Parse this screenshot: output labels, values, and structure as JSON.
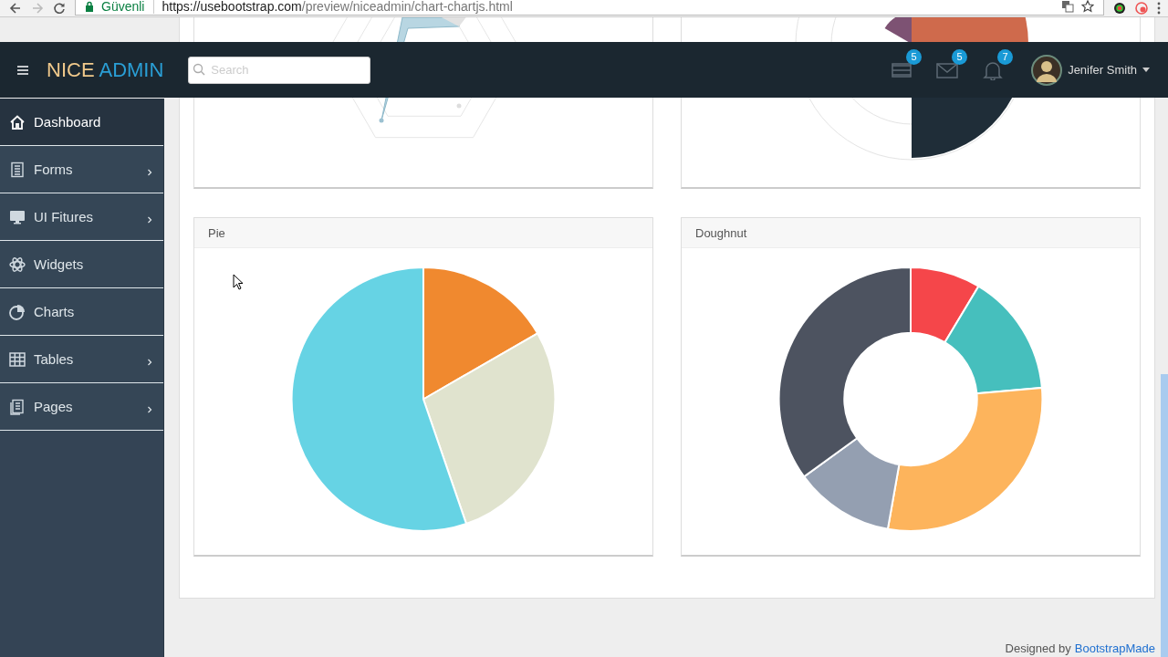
{
  "browser": {
    "security_label": "Güvenli",
    "url_domain": "https://usebootstrap.com",
    "url_path": "/preview/niceadmin/chart-chartjs.html"
  },
  "header": {
    "logo_first": "NICE",
    "logo_second": "ADMIN",
    "search": {
      "placeholder": "Search"
    },
    "notifications": [
      {
        "kind": "tasks",
        "count": "5"
      },
      {
        "kind": "messages",
        "count": "5"
      },
      {
        "kind": "alerts",
        "count": "7"
      }
    ],
    "user": {
      "name": "Jenifer Smith"
    }
  },
  "sidebar": {
    "items": [
      {
        "kind": "dashboard",
        "label": "Dashboard",
        "selected": true,
        "has_submenu": false
      },
      {
        "kind": "forms",
        "label": "Forms",
        "selected": false,
        "has_submenu": true
      },
      {
        "kind": "ui",
        "label": "UI Fitures",
        "selected": false,
        "has_submenu": true
      },
      {
        "kind": "widgets",
        "label": "Widgets",
        "selected": false,
        "has_submenu": false
      },
      {
        "kind": "charts",
        "label": "Charts",
        "selected": false,
        "has_submenu": false
      },
      {
        "kind": "tables",
        "label": "Tables",
        "selected": false,
        "has_submenu": true
      },
      {
        "kind": "pages",
        "label": "Pages",
        "selected": false,
        "has_submenu": true
      }
    ]
  },
  "cards": [
    {
      "kind": "pie",
      "title": "Pie"
    },
    {
      "kind": "doughnut",
      "title": "Doughnut"
    }
  ],
  "footer": {
    "text": "Designed by",
    "link": "BootstrapMade"
  }
}
